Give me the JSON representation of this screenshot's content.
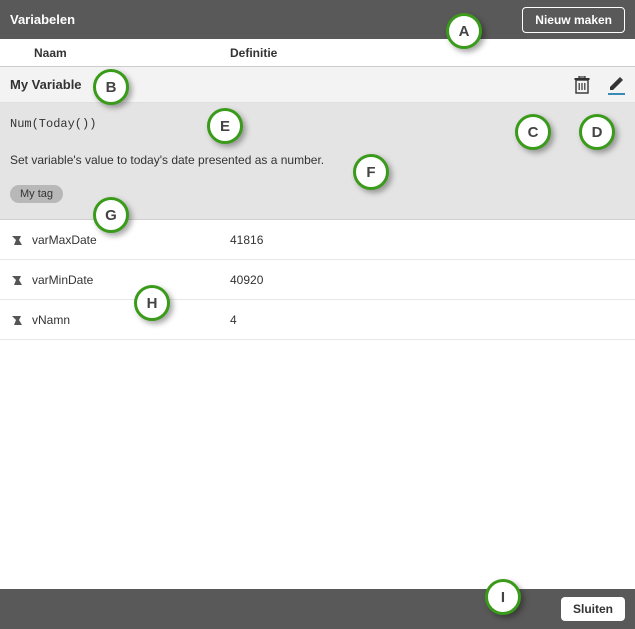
{
  "header": {
    "title": "Variabelen",
    "new_button_label": "Nieuw maken"
  },
  "columns": {
    "name_label": "Naam",
    "definition_label": "Definitie"
  },
  "selected": {
    "name": "My Variable",
    "definition_code": "Num(Today())",
    "description": "Set variable's value to today's date presented as a number.",
    "tag": "My tag"
  },
  "variables": [
    {
      "name": "varMaxDate",
      "value": "41816"
    },
    {
      "name": "varMinDate",
      "value": "40920"
    },
    {
      "name": "vNamn",
      "value": "4"
    }
  ],
  "footer": {
    "close_label": "Sluiten"
  },
  "annotations": {
    "A": "A",
    "B": "B",
    "C": "C",
    "D": "D",
    "E": "E",
    "F": "F",
    "G": "G",
    "H": "H",
    "I": "I"
  }
}
